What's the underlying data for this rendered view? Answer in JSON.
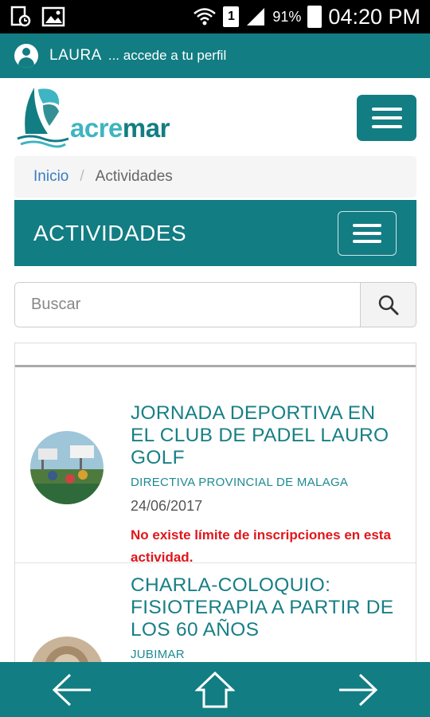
{
  "status_bar": {
    "signal_label": "1",
    "battery": "91%",
    "time": "04:20 PM"
  },
  "profile": {
    "name": "LAURA",
    "subtitle": "... accede a tu perfil"
  },
  "header": {
    "logo_text_part1": "acre",
    "logo_text_part2": "mar"
  },
  "breadcrumb": {
    "home": "Inicio",
    "separator": "/",
    "current": "Actividades"
  },
  "section": {
    "title": "ACTIVIDADES"
  },
  "search": {
    "placeholder": "Buscar"
  },
  "activities": [
    {
      "title": "JORNADA DEPORTIVA EN EL CLUB DE PADEL LAURO GOLF",
      "organizer": "DIRECTIVA PROVINCIAL DE MALAGA",
      "date": "24/06/2017",
      "note": "No existe límite de inscripciones en esta actividad."
    },
    {
      "title": "CHARLA-COLOQUIO: FISIOTERAPIA A PARTIR DE LOS 60 AÑOS",
      "organizer": "JUBIMAR"
    }
  ],
  "colors": {
    "brand": "#127d83",
    "title_teal": "#187f86",
    "alert_red": "#e0161b",
    "link_blue": "#3a7bbf"
  }
}
